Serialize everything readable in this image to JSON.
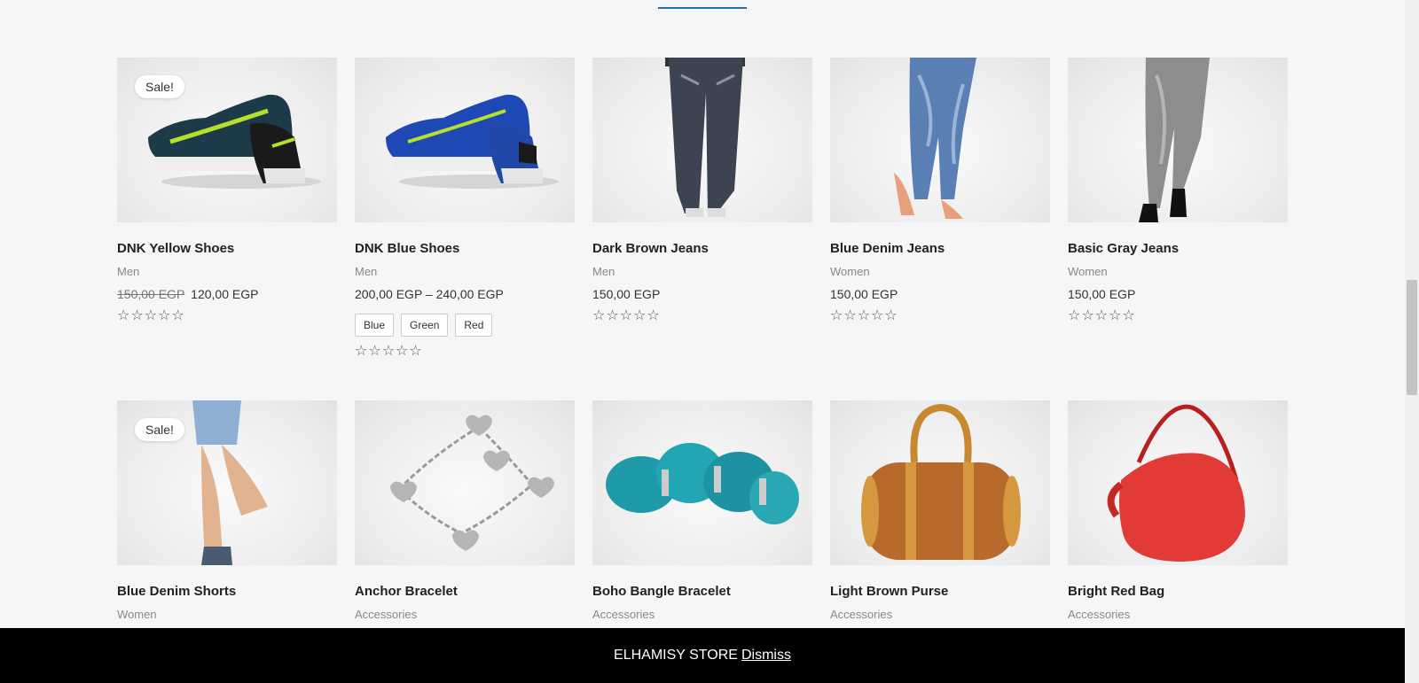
{
  "products_row1": [
    {
      "title": "DNK Yellow Shoes",
      "category": "Men",
      "old_price": "150,00 EGP",
      "price": "120,00 EGP",
      "sale_badge": "Sale!",
      "image": "yellow-sneakers"
    },
    {
      "title": "DNK Blue Shoes",
      "category": "Men",
      "price": "200,00 EGP – 240,00 EGP",
      "swatches": [
        "Blue",
        "Green",
        "Red"
      ],
      "image": "blue-sneakers"
    },
    {
      "title": "Dark Brown Jeans",
      "category": "Men",
      "price": "150,00 EGP",
      "image": "dark-jeans"
    },
    {
      "title": "Blue Denim Jeans",
      "category": "Women",
      "price": "150,00 EGP",
      "image": "blue-jeans"
    },
    {
      "title": "Basic Gray Jeans",
      "category": "Women",
      "price": "150,00 EGP",
      "image": "gray-jeans"
    }
  ],
  "products_row2": [
    {
      "title": "Blue Denim Shorts",
      "category": "Women",
      "sale_badge": "Sale!",
      "image": "denim-shorts"
    },
    {
      "title": "Anchor Bracelet",
      "category": "Accessories",
      "image": "silver-bracelet"
    },
    {
      "title": "Boho Bangle Bracelet",
      "category": "Accessories",
      "image": "turquoise-bracelet"
    },
    {
      "title": "Light Brown Purse",
      "category": "Accessories",
      "image": "brown-purse"
    },
    {
      "title": "Bright Red Bag",
      "category": "Accessories",
      "image": "red-bag"
    }
  ],
  "rating_stars": "☆☆☆☆☆",
  "store_notice": {
    "text": "ELHAMISY STORE",
    "dismiss": "Dismiss"
  },
  "colors": {
    "accent": "#1f6fa8",
    "notice_bg": "#000000",
    "page_bg": "#f5f6f8"
  }
}
